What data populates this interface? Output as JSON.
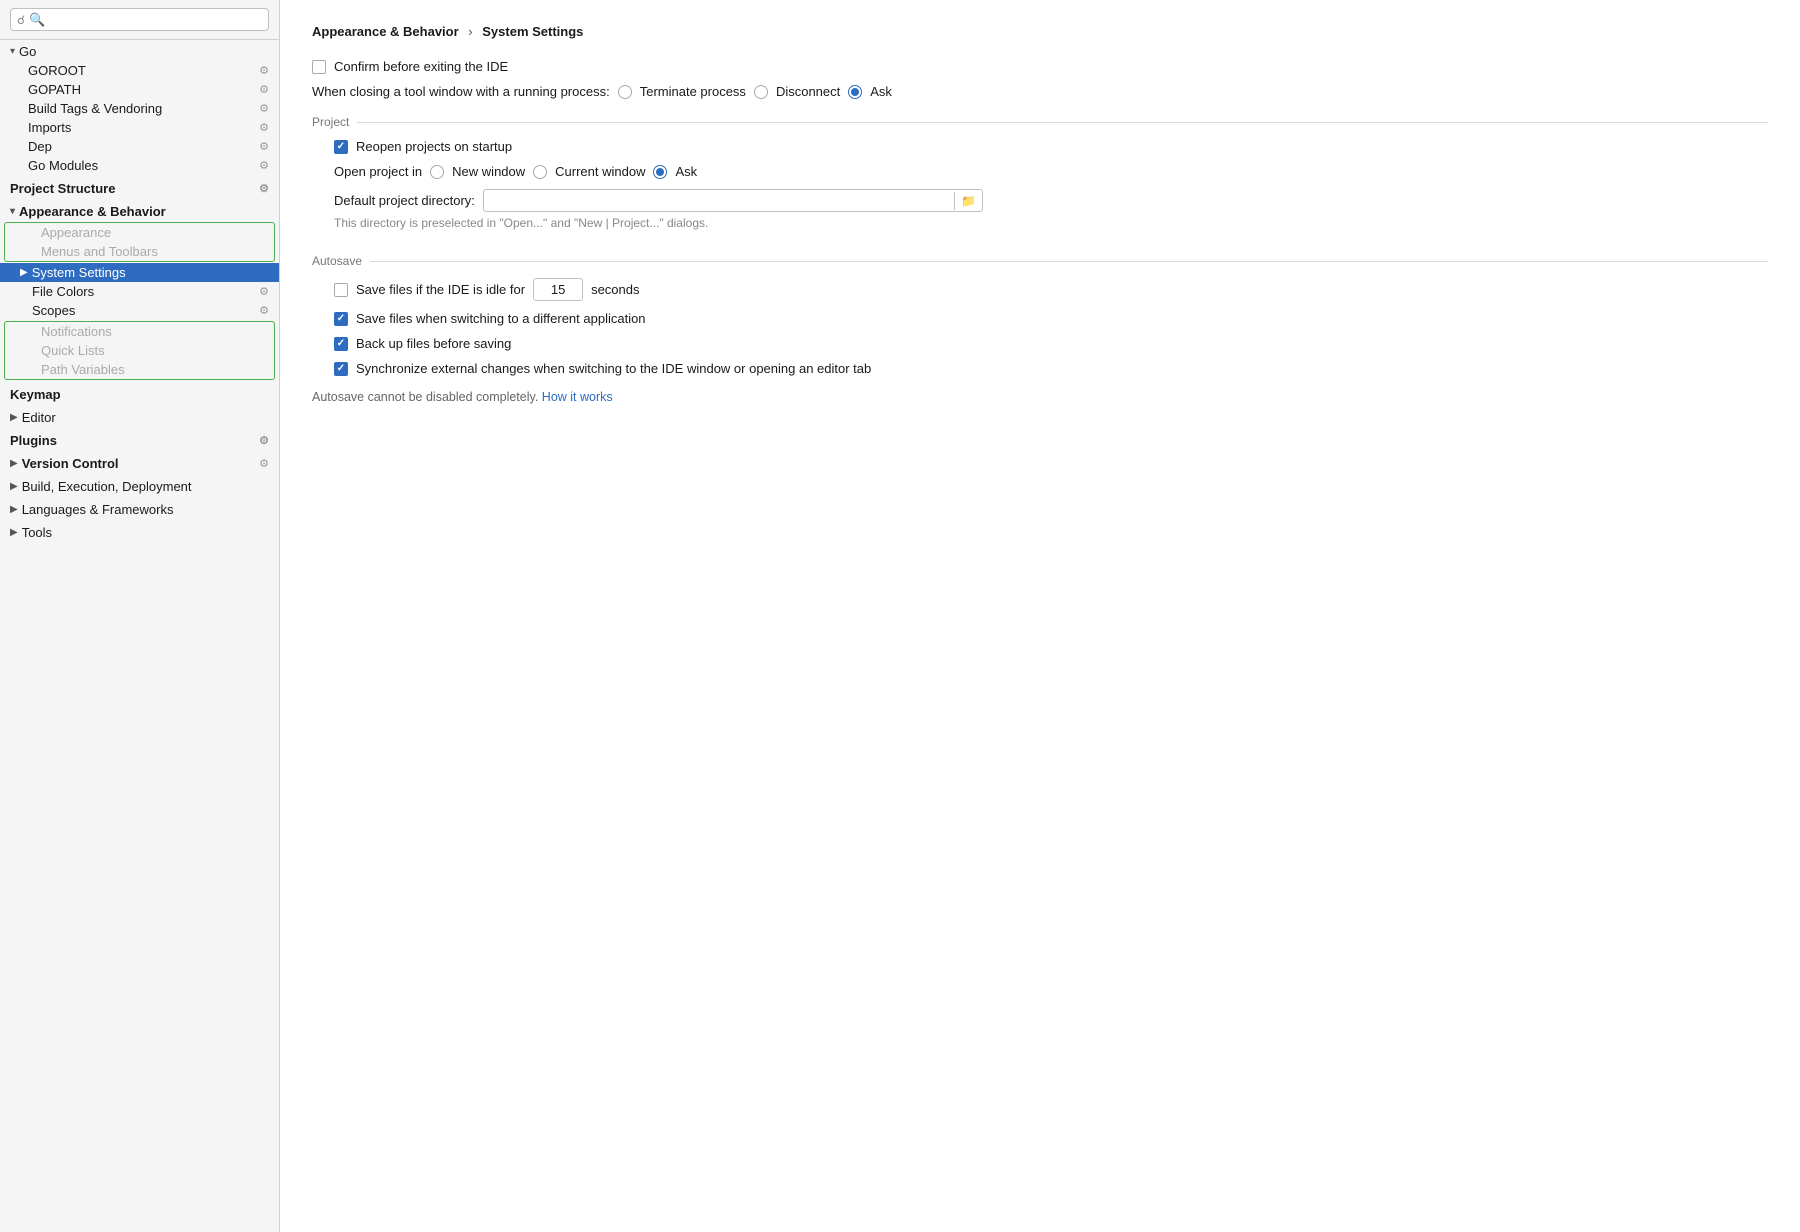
{
  "sidebar": {
    "search_placeholder": "☉",
    "items": [
      {
        "id": "go",
        "label": "Go",
        "level": 0,
        "chevron": "▾",
        "bold": false,
        "active": false,
        "has_icon": false
      },
      {
        "id": "goroot",
        "label": "GOROOT",
        "level": 1,
        "bold": false,
        "active": false,
        "has_icon": true
      },
      {
        "id": "gopath",
        "label": "GOPATH",
        "level": 1,
        "bold": false,
        "active": false,
        "has_icon": true
      },
      {
        "id": "build-tags",
        "label": "Build Tags & Vendoring",
        "level": 1,
        "bold": false,
        "active": false,
        "has_icon": true
      },
      {
        "id": "imports",
        "label": "Imports",
        "level": 1,
        "bold": false,
        "active": false,
        "has_icon": true
      },
      {
        "id": "dep",
        "label": "Dep",
        "level": 1,
        "bold": false,
        "active": false,
        "has_icon": true
      },
      {
        "id": "go-modules",
        "label": "Go Modules",
        "level": 1,
        "bold": false,
        "active": false,
        "has_icon": true
      },
      {
        "id": "project-structure",
        "label": "Project Structure",
        "level": 0,
        "bold": true,
        "active": false,
        "has_icon": true
      },
      {
        "id": "appearance-behavior",
        "label": "Appearance & Behavior",
        "level": 0,
        "chevron": "▾",
        "bold": true,
        "active": false,
        "has_icon": false
      },
      {
        "id": "appearance",
        "label": "Appearance",
        "level": 1,
        "bold": false,
        "active": false,
        "has_icon": false,
        "disabled": true
      },
      {
        "id": "menus-toolbars",
        "label": "Menus and Toolbars",
        "level": 1,
        "bold": false,
        "active": false,
        "has_icon": false,
        "disabled": true
      },
      {
        "id": "system-settings",
        "label": "System Settings",
        "level": 1,
        "chevron": "▶",
        "bold": false,
        "active": true,
        "has_icon": false
      },
      {
        "id": "file-colors",
        "label": "File Colors",
        "level": 1,
        "bold": false,
        "active": false,
        "has_icon": true
      },
      {
        "id": "scopes",
        "label": "Scopes",
        "level": 1,
        "bold": false,
        "active": false,
        "has_icon": true
      },
      {
        "id": "notifications",
        "label": "Notifications",
        "level": 1,
        "bold": false,
        "active": false,
        "has_icon": false,
        "disabled": true
      },
      {
        "id": "quick-lists",
        "label": "Quick Lists",
        "level": 1,
        "bold": false,
        "active": false,
        "has_icon": false,
        "disabled": true
      },
      {
        "id": "path-variables",
        "label": "Path Variables",
        "level": 1,
        "bold": false,
        "active": false,
        "has_icon": false,
        "disabled": true
      },
      {
        "id": "keymap",
        "label": "Keymap",
        "level": 0,
        "bold": true,
        "active": false,
        "has_icon": false
      },
      {
        "id": "editor",
        "label": "Editor",
        "level": 0,
        "chevron": "▶",
        "bold": false,
        "active": false,
        "has_icon": false
      },
      {
        "id": "plugins",
        "label": "Plugins",
        "level": 0,
        "bold": true,
        "active": false,
        "has_icon": true
      },
      {
        "id": "version-control",
        "label": "Version Control",
        "level": 0,
        "chevron": "▶",
        "bold": false,
        "active": false,
        "has_icon": true
      },
      {
        "id": "build-exec-deploy",
        "label": "Build, Execution, Deployment",
        "level": 0,
        "chevron": "▶",
        "bold": false,
        "active": false,
        "has_icon": false
      },
      {
        "id": "languages-frameworks",
        "label": "Languages & Frameworks",
        "level": 0,
        "chevron": "▶",
        "bold": false,
        "active": false,
        "has_icon": false
      },
      {
        "id": "tools",
        "label": "Tools",
        "level": 0,
        "chevron": "▶",
        "bold": false,
        "active": false,
        "has_icon": false
      }
    ]
  },
  "main": {
    "breadcrumb_part1": "Appearance & Behavior",
    "breadcrumb_sep": "›",
    "breadcrumb_part2": "System Settings",
    "confirm_exit_label": "Confirm before exiting the IDE",
    "confirm_exit_checked": false,
    "tool_window_label": "When closing a tool window with a running process:",
    "terminate_label": "Terminate process",
    "terminate_selected": false,
    "disconnect_label": "Disconnect",
    "disconnect_selected": false,
    "ask_label": "Ask",
    "ask_selected": true,
    "project_section": "Project",
    "reopen_label": "Reopen projects on startup",
    "reopen_checked": true,
    "open_project_label": "Open project in",
    "new_window_label": "New window",
    "new_window_selected": false,
    "current_window_label": "Current window",
    "current_window_selected": false,
    "ask_project_label": "Ask",
    "ask_project_selected": true,
    "default_dir_label": "Default project directory:",
    "default_dir_value": "",
    "default_dir_hint": "This directory is preselected in \"Open...\" and \"New | Project...\" dialogs.",
    "autosave_section": "Autosave",
    "save_idle_label": "Save files if the IDE is idle for",
    "save_idle_checked": false,
    "save_idle_seconds": "15",
    "save_idle_unit": "seconds",
    "save_switch_label": "Save files when switching to a different application",
    "save_switch_checked": true,
    "backup_label": "Back up files before saving",
    "backup_checked": true,
    "sync_label": "Synchronize external changes when switching to the IDE window or opening an editor tab",
    "sync_checked": true,
    "autosave_note": "Autosave cannot be disabled completely.",
    "how_it_works_label": "How it works"
  }
}
